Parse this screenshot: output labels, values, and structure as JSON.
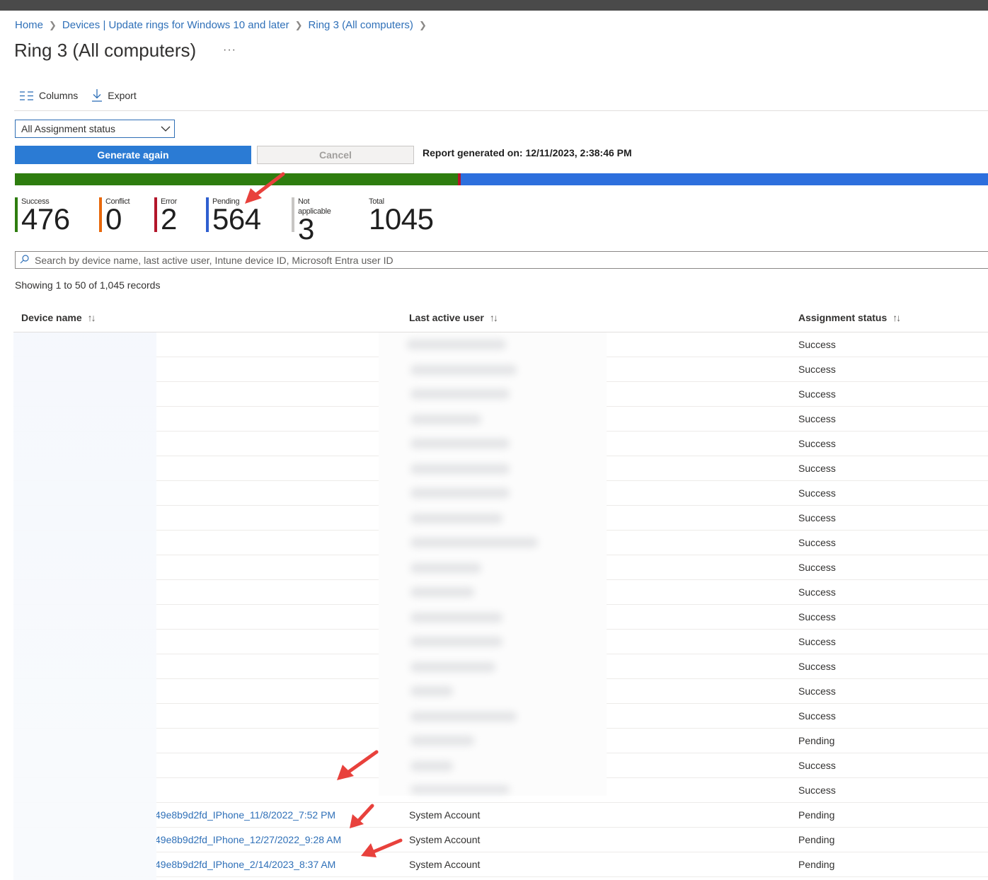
{
  "breadcrumb": {
    "items": [
      "Home",
      "Devices | Update rings for Windows 10 and later",
      "Ring 3 (All computers)"
    ],
    "sep": ">"
  },
  "page": {
    "title": "Ring 3 (All computers)",
    "more": "···"
  },
  "toolbar": {
    "columns_label": "Columns",
    "export_label": "Export"
  },
  "filter": {
    "selected": "All Assignment status"
  },
  "actions": {
    "generate_label": "Generate again",
    "cancel_label": "Cancel",
    "report_generated": "Report generated on: 12/11/2023, 2:38:46 PM"
  },
  "stats": [
    {
      "label": "Success",
      "value": "476",
      "color": "#2e7d0f"
    },
    {
      "label": "Conflict",
      "value": "0",
      "color": "#e8680c"
    },
    {
      "label": "Error",
      "value": "2",
      "color": "#b3162b"
    },
    {
      "label": "Pending",
      "value": "564",
      "color": "#2f5fd0"
    },
    {
      "label": "Not applicable",
      "value": "3",
      "color": "#c8c6c4"
    },
    {
      "label": "Total",
      "value": "1045",
      "color": ""
    }
  ],
  "progress": {
    "success_fraction": 0.455,
    "error_fraction": 0.003,
    "pending_fraction": 0.542,
    "colors": {
      "success": "#2e7d0f",
      "error": "#b3162b",
      "pending": "#2d6fdd"
    }
  },
  "search": {
    "placeholder": "Search by device name, last active user, Intune device ID, Microsoft Entra user ID"
  },
  "showing": "Showing 1 to 50 of 1,045 records",
  "table": {
    "columns": [
      {
        "label": "Device name",
        "sort": "↑↓"
      },
      {
        "label": "Last active user",
        "sort": "↑↓"
      },
      {
        "label": "Assignment status",
        "sort": "↑↓"
      }
    ],
    "rows": [
      {
        "device": "",
        "user": "",
        "status": "Success"
      },
      {
        "device": "",
        "user": "",
        "status": "Success"
      },
      {
        "device": "",
        "user": "",
        "status": "Success"
      },
      {
        "device": "",
        "user": "",
        "status": "Success"
      },
      {
        "device": "",
        "user": "",
        "status": "Success"
      },
      {
        "device": "",
        "user": "",
        "status": "Success"
      },
      {
        "device": "",
        "user": "",
        "status": "Success"
      },
      {
        "device": "",
        "user": "",
        "status": "Success"
      },
      {
        "device": "",
        "user": "",
        "status": "Success"
      },
      {
        "device": "",
        "user": "",
        "status": "Success"
      },
      {
        "device": "",
        "user": "",
        "status": "Success"
      },
      {
        "device": "",
        "user": "",
        "status": "Success"
      },
      {
        "device": "",
        "user": "",
        "status": "Success"
      },
      {
        "device": "",
        "user": "",
        "status": "Success"
      },
      {
        "device": "",
        "user": "",
        "status": "Success"
      },
      {
        "device": "",
        "user": "",
        "status": "Success"
      },
      {
        "device": "",
        "user": "",
        "status": "Pending"
      },
      {
        "device": "",
        "user": "",
        "status": "Success"
      },
      {
        "device": "",
        "user": "",
        "status": "Success"
      },
      {
        "device": "49e8b9d2fd_IPhone_11/8/2022_7:52 PM",
        "user": "System Account",
        "status": "Pending"
      },
      {
        "device": "49e8b9d2fd_IPhone_12/27/2022_9:28 AM",
        "user": "System Account",
        "status": "Pending"
      },
      {
        "device": "49e8b9d2fd_IPhone_2/14/2023_8:37 AM",
        "user": "System Account",
        "status": "Pending"
      }
    ]
  },
  "annotation_color": "#e8413c"
}
